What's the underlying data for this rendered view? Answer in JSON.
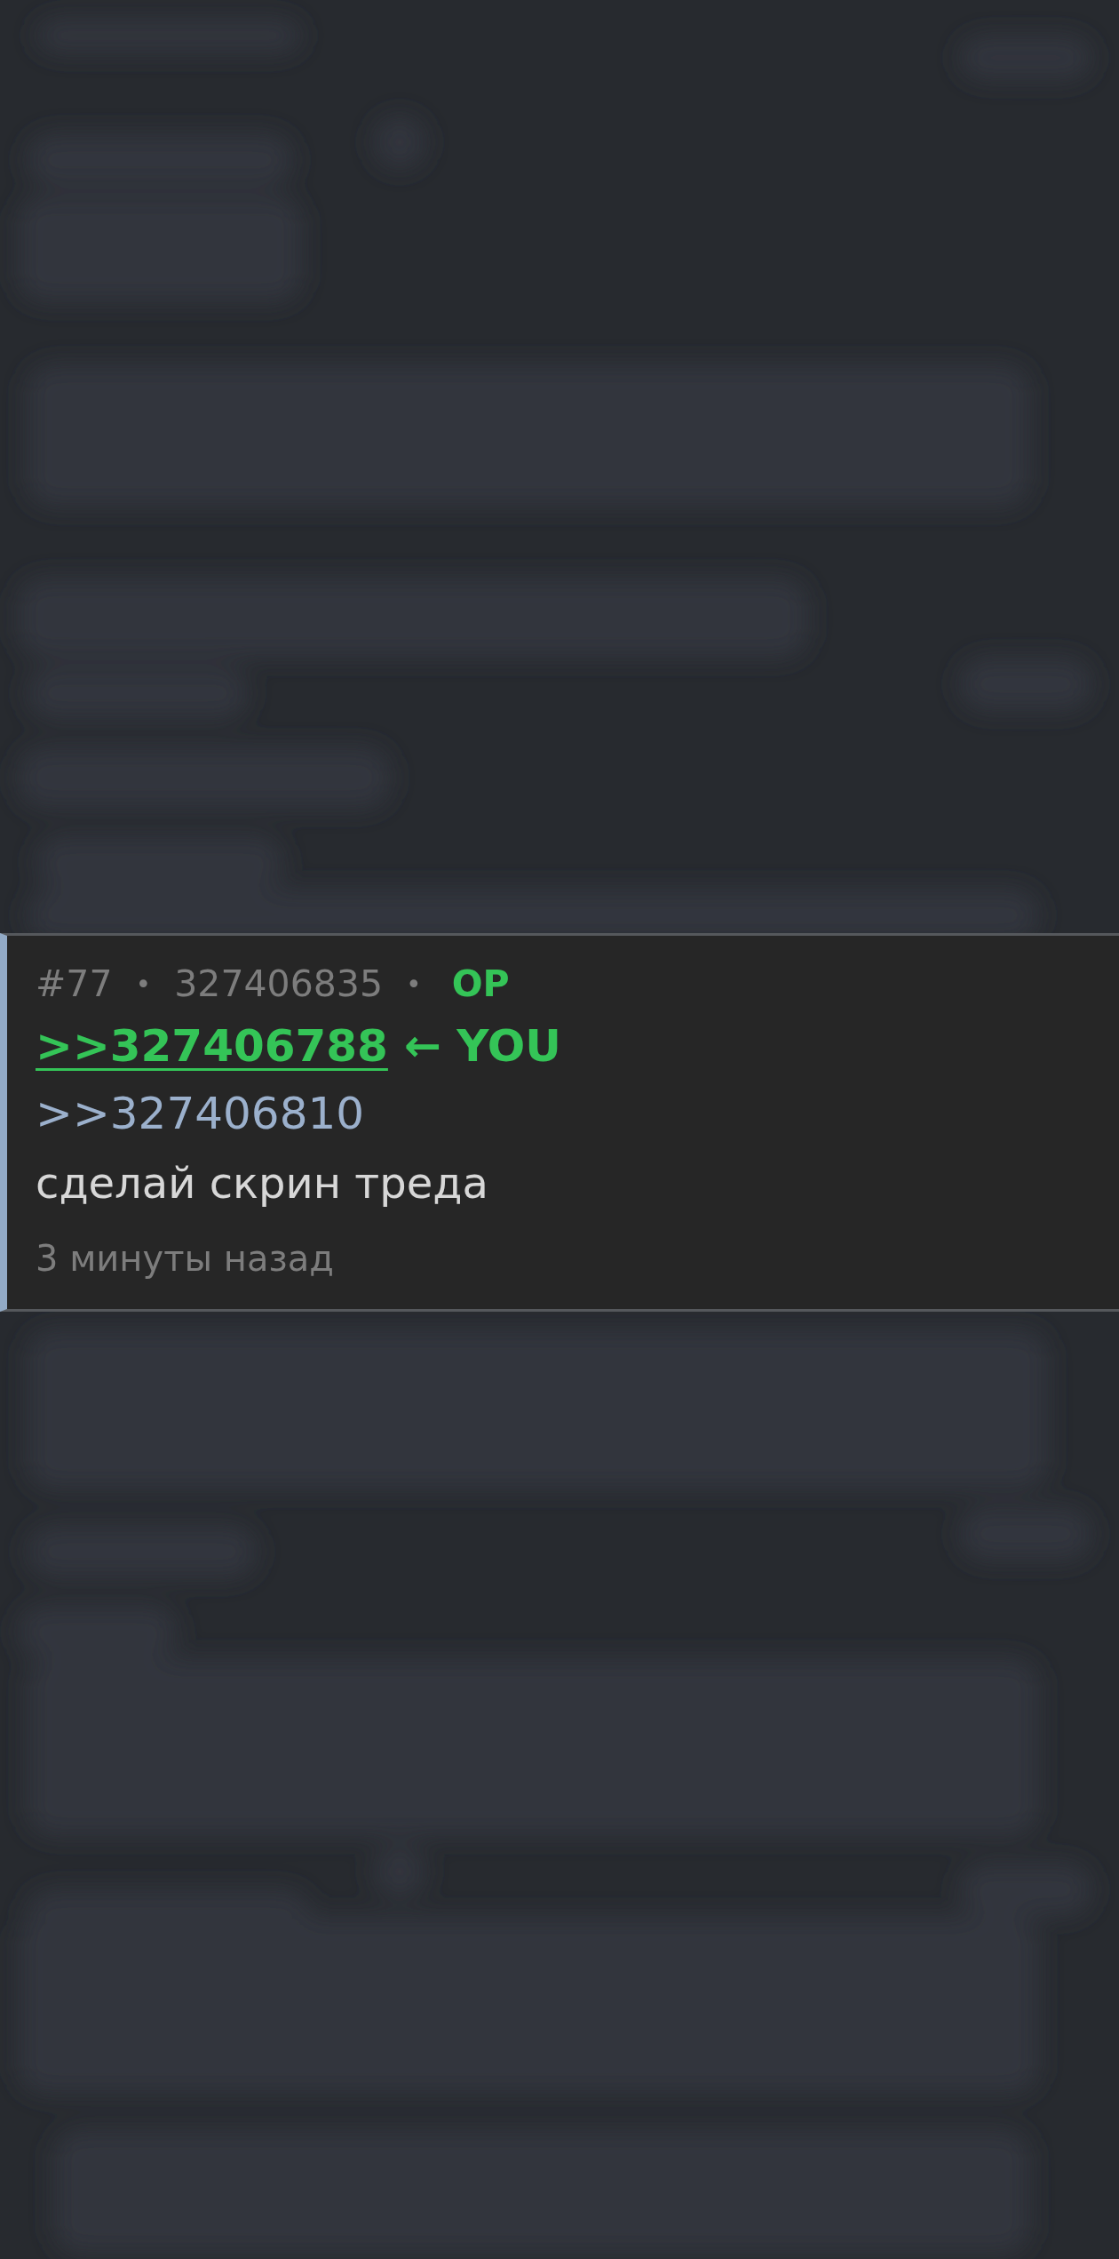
{
  "post": {
    "number": "#77",
    "separator": "•",
    "post_id": "327406835",
    "op_separator": "•",
    "op_label": "OP",
    "replies": [
      {
        "kind": "own",
        "text": ">>327406788",
        "marker": "← YOU"
      },
      {
        "kind": "plain",
        "text": ">>327406810"
      }
    ],
    "body": "сделай скрин треда",
    "time": "3 минуты назад"
  }
}
